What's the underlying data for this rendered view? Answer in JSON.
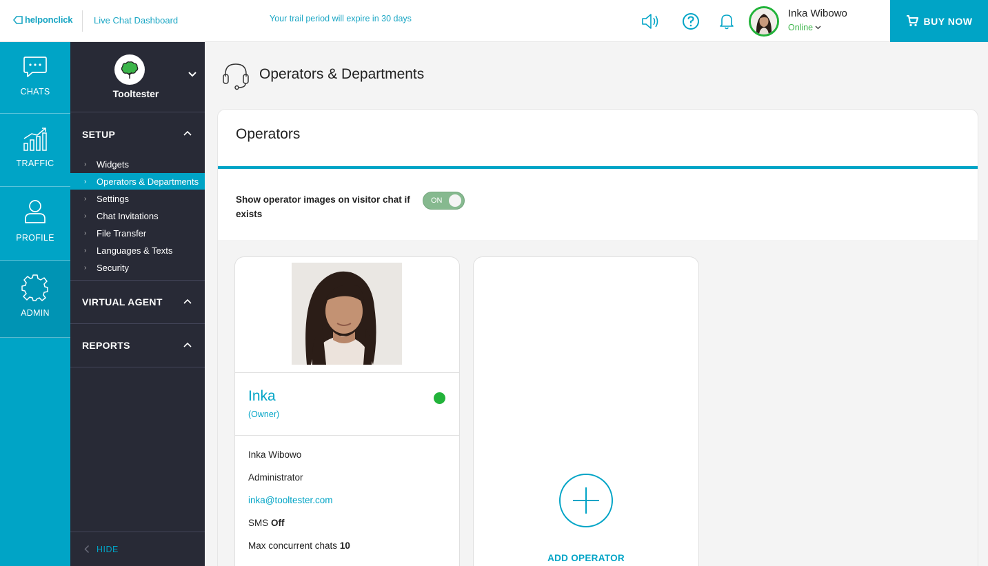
{
  "topbar": {
    "logo_text": "helponclick",
    "app_title": "Live Chat Dashboard",
    "trial_notice": "Your trail period will expire in 30 days",
    "user_name": "Inka Wibowo",
    "user_status": "Online",
    "buy_now": "BUY NOW",
    "accent": "#00a4c6",
    "status_color": "#22b33a"
  },
  "rail": {
    "items": [
      {
        "label": "CHATS",
        "icon": "chat-bubble-icon"
      },
      {
        "label": "TRAFFIC",
        "icon": "bar-chart-icon"
      },
      {
        "label": "PROFILE",
        "icon": "person-icon"
      },
      {
        "label": "ADMIN",
        "icon": "gear-icon",
        "active": true
      }
    ]
  },
  "sidebar": {
    "brand_name": "Tooltester",
    "setup_label": "SETUP",
    "setup_items": [
      {
        "label": "Widgets"
      },
      {
        "label": "Operators & Departments",
        "active": true
      },
      {
        "label": "Settings"
      },
      {
        "label": "Chat Invitations"
      },
      {
        "label": "File Transfer"
      },
      {
        "label": "Languages & Texts"
      },
      {
        "label": "Security"
      }
    ],
    "virtual_agent_label": "VIRTUAL AGENT",
    "reports_label": "REPORTS",
    "hide_label": "HIDE"
  },
  "main": {
    "page_title": "Operators & Departments",
    "panel_title": "Operators",
    "setting_label": "Show operator images on visitor chat if exists",
    "toggle_label": "ON",
    "toggle_on": true,
    "operator": {
      "display_name": "Inka",
      "role": "(Owner)",
      "full_name": "Inka Wibowo",
      "access": "Administrator",
      "email": "inka@tooltester.com",
      "sms_label": "SMS",
      "sms_value": "Off",
      "max_label": "Max concurrent chats",
      "max_value": "10",
      "online": true
    },
    "add_operator_label": "ADD OPERATOR"
  }
}
